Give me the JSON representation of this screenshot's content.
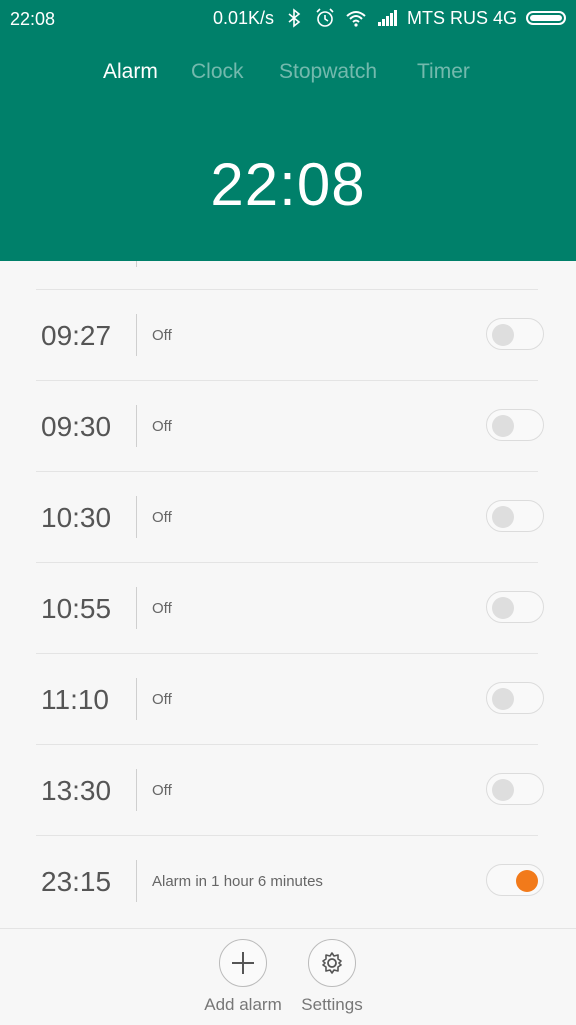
{
  "status_bar": {
    "time": "22:08",
    "speed": "0.01K/s",
    "carrier": "MTS RUS 4G"
  },
  "tabs": [
    {
      "label": "Alarm",
      "active": true
    },
    {
      "label": "Clock",
      "active": false
    },
    {
      "label": "Stopwatch",
      "active": false
    },
    {
      "label": "Timer",
      "active": false
    }
  ],
  "current_time": "22:08",
  "alarms": [
    {
      "time": "09:27",
      "status": "Off",
      "enabled": false
    },
    {
      "time": "09:30",
      "status": "Off",
      "enabled": false
    },
    {
      "time": "10:30",
      "status": "Off",
      "enabled": false
    },
    {
      "time": "10:55",
      "status": "Off",
      "enabled": false
    },
    {
      "time": "11:10",
      "status": "Off",
      "enabled": false
    },
    {
      "time": "13:30",
      "status": "Off",
      "enabled": false
    },
    {
      "time": "23:15",
      "status": "Alarm in 1 hour 6 minutes",
      "enabled": true
    }
  ],
  "actions": {
    "add_label": "Add alarm",
    "settings_label": "Settings"
  },
  "colors": {
    "header": "#00806a",
    "toggle_on": "#f27a1a"
  }
}
